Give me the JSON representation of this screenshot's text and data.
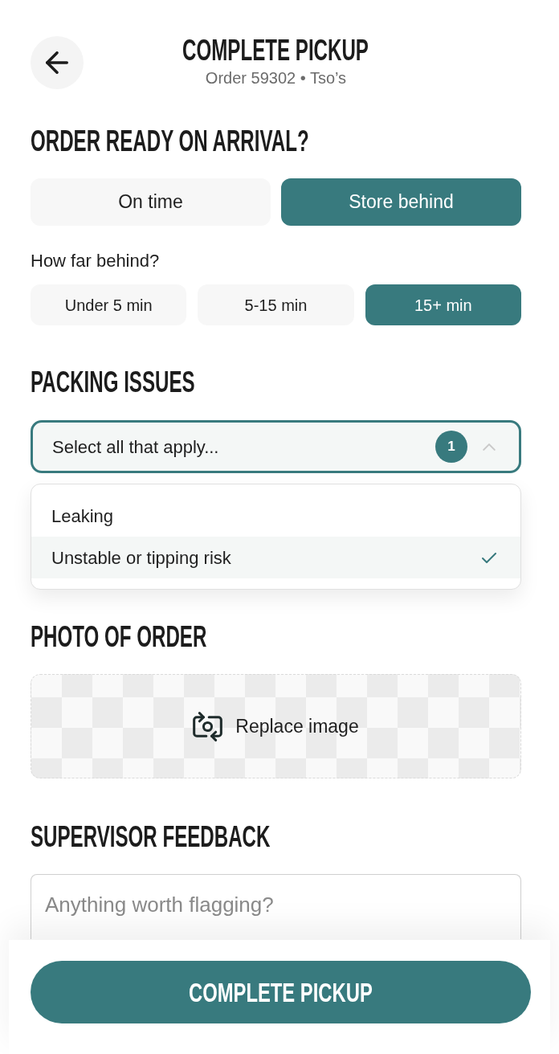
{
  "header": {
    "title": "COMPLETE PICKUP",
    "subtitle": "Order 59302 • Tso’s"
  },
  "arrival": {
    "heading": "ORDER READY ON ARRIVAL?",
    "options": [
      {
        "label": "On time",
        "selected": false
      },
      {
        "label": "Store behind",
        "selected": true
      }
    ],
    "delay_prompt": "How far behind?",
    "delay_options": [
      {
        "label": "Under 5 min",
        "selected": false
      },
      {
        "label": "5-15 min",
        "selected": false
      },
      {
        "label": "15+ min",
        "selected": true
      }
    ]
  },
  "packing_issues": {
    "heading": "PACKING ISSUES",
    "select": {
      "prompt": "Select all that apply...",
      "selected_count": "1",
      "expanded": true
    },
    "options": [
      {
        "label": "Leaking",
        "selected": false
      },
      {
        "label": "Unstable or tipping risk",
        "selected": true
      }
    ]
  },
  "photo": {
    "heading": "PHOTO OF ORDER",
    "action": "Replace image"
  },
  "feedback": {
    "heading": "SUPERVISOR FEEDBACK",
    "placeholder": "Anything worth flagging?"
  },
  "submit_button": "COMPLETE PICKUP"
}
